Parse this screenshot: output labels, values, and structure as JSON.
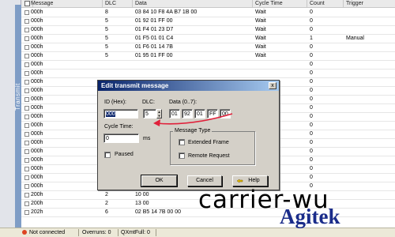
{
  "side_tab": {
    "label": "Transmit"
  },
  "grid": {
    "columns": [
      "Message",
      "DLC",
      "Data",
      "Cycle Time",
      "Count",
      "Trigger"
    ],
    "rows": [
      {
        "message": "000h",
        "dlc": "8",
        "data": "03 84 10 F8 4A B7 1B 00",
        "cycle": "Wait",
        "count": "0",
        "trigger": ""
      },
      {
        "message": "000h",
        "dlc": "5",
        "data": "01 92 01 FF 00",
        "cycle": "Wait",
        "count": "0",
        "trigger": ""
      },
      {
        "message": "000h",
        "dlc": "5",
        "data": "01 F4 01 23 D7",
        "cycle": "Wait",
        "count": "0",
        "trigger": ""
      },
      {
        "message": "000h",
        "dlc": "5",
        "data": "01 F5 01 01 C4",
        "cycle": "Wait",
        "count": "1",
        "trigger": "Manual"
      },
      {
        "message": "000h",
        "dlc": "5",
        "data": "01 F6 01 14 7B",
        "cycle": "Wait",
        "count": "0",
        "trigger": ""
      },
      {
        "message": "000h",
        "dlc": "5",
        "data": "01 95 01 FF 00",
        "cycle": "Wait",
        "count": "0",
        "trigger": ""
      },
      {
        "message": "000h",
        "dlc": "",
        "data": "",
        "cycle": "",
        "count": "0",
        "trigger": ""
      },
      {
        "message": "000h",
        "dlc": "",
        "data": "",
        "cycle": "",
        "count": "0",
        "trigger": ""
      },
      {
        "message": "000h",
        "dlc": "",
        "data": "",
        "cycle": "",
        "count": "0",
        "trigger": ""
      },
      {
        "message": "000h",
        "dlc": "",
        "data": "",
        "cycle": "",
        "count": "0",
        "trigger": ""
      },
      {
        "message": "000h",
        "dlc": "",
        "data": "",
        "cycle": "",
        "count": "0",
        "trigger": ""
      },
      {
        "message": "000h",
        "dlc": "",
        "data": "",
        "cycle": "",
        "count": "0",
        "trigger": ""
      },
      {
        "message": "000h",
        "dlc": "",
        "data": "",
        "cycle": "",
        "count": "0",
        "trigger": ""
      },
      {
        "message": "000h",
        "dlc": "",
        "data": "",
        "cycle": "",
        "count": "0",
        "trigger": ""
      },
      {
        "message": "000h",
        "dlc": "",
        "data": "",
        "cycle": "",
        "count": "0",
        "trigger": ""
      },
      {
        "message": "000h",
        "dlc": "",
        "data": "",
        "cycle": "Wait",
        "count": "0",
        "trigger": ""
      },
      {
        "message": "000h",
        "dlc": "",
        "data": "",
        "cycle": "Wait",
        "count": "0",
        "trigger": ""
      },
      {
        "message": "000h",
        "dlc": "",
        "data": "",
        "cycle": "Wait",
        "count": "0",
        "trigger": ""
      },
      {
        "message": "000h",
        "dlc": "",
        "data": "",
        "cycle": "Wait",
        "count": "0",
        "trigger": ""
      },
      {
        "message": "000h",
        "dlc": "",
        "data": "",
        "cycle": "Wait",
        "count": "0",
        "trigger": ""
      },
      {
        "message": "000h",
        "dlc": "",
        "data": "",
        "cycle": "Wait",
        "count": "0",
        "trigger": ""
      },
      {
        "message": "200h",
        "dlc": "2",
        "data": "10 00",
        "cycle": "",
        "count": "",
        "trigger": ""
      },
      {
        "message": "200h",
        "dlc": "2",
        "data": "13 00",
        "cycle": "",
        "count": "",
        "trigger": ""
      },
      {
        "message": "202h",
        "dlc": "6",
        "data": "02 B5 14 7B 00 00",
        "cycle": "",
        "count": "",
        "trigger": ""
      }
    ]
  },
  "status": {
    "connection": "Not connected",
    "overruns": "Overruns: 0",
    "qxmtfull": "QXmtFull: 0"
  },
  "dialog": {
    "title": "Edit transmit message",
    "close_label": "x",
    "id_label": "ID (Hex):",
    "id_value": "000",
    "dlc_label": "DLC:",
    "dlc_value": "5",
    "data_label": "Data (0..7):",
    "data_bytes": [
      "01",
      "92",
      "01",
      "FF",
      "00"
    ],
    "cycle_label": "Cycle Time:",
    "cycle_value": "0",
    "cycle_unit": "ms",
    "paused_label": "Paused",
    "msg_type_label": "Message Type",
    "extended_label": "Extended Frame",
    "remote_label": "Remote Request",
    "ok_label": "OK",
    "cancel_label": "Cancel",
    "help_label": "Help"
  },
  "overlay": {
    "text1": "carrier-wu",
    "text2": "Agitek"
  },
  "colors": {
    "title_bar": "#0a246a",
    "arrow": "#e0203a",
    "side_band": "#7f9dc6",
    "agitek": "#1a2c8a"
  }
}
